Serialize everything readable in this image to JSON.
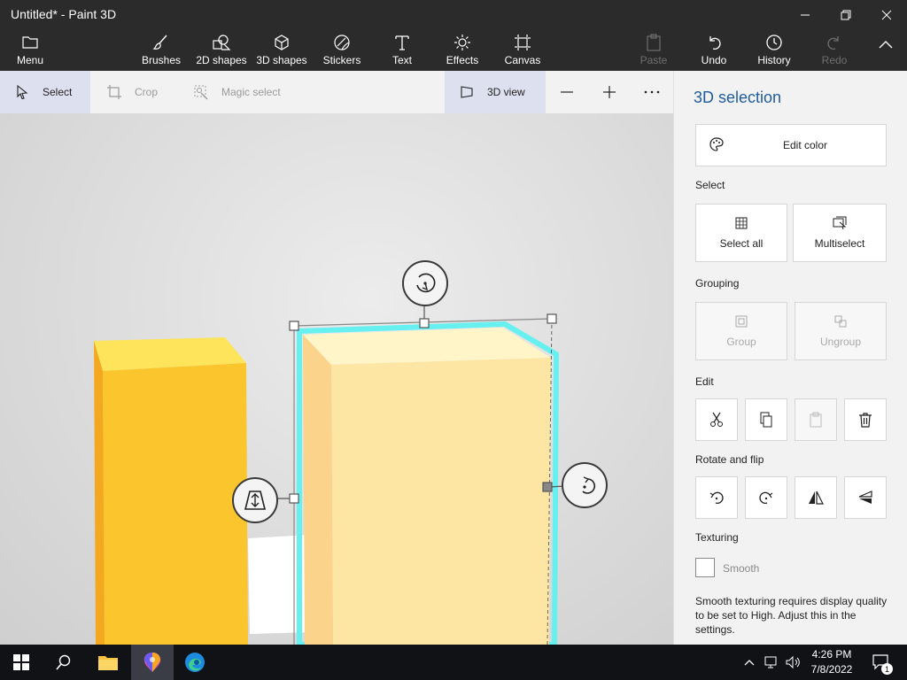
{
  "window": {
    "title": "Untitled* - Paint 3D"
  },
  "ribbon": {
    "menu": "Menu",
    "tools": [
      {
        "label": "Brushes"
      },
      {
        "label": "2D shapes"
      },
      {
        "label": "3D shapes"
      },
      {
        "label": "Stickers"
      },
      {
        "label": "Text"
      },
      {
        "label": "Effects"
      },
      {
        "label": "Canvas"
      }
    ],
    "paste": "Paste",
    "undo": "Undo",
    "history": "History",
    "redo": "Redo"
  },
  "toolbar": {
    "select": "Select",
    "crop": "Crop",
    "magic_select": "Magic select",
    "view3d": "3D view",
    "zoom_out": "—",
    "zoom_in": "+",
    "more": "···"
  },
  "panel": {
    "title": "3D selection",
    "edit_color": "Edit color",
    "select_label": "Select",
    "select_all": "Select all",
    "multiselect": "Multiselect",
    "grouping_label": "Grouping",
    "group": "Group",
    "ungroup": "Ungroup",
    "edit_label": "Edit",
    "rotate_label": "Rotate and flip",
    "texturing_label": "Texturing",
    "smooth": "Smooth",
    "note": "Smooth texturing requires display quality to be set to High. Adjust this in the settings."
  },
  "taskbar": {
    "time": "4:26 PM",
    "date": "7/8/2022",
    "notification_count": "1"
  },
  "colors": {
    "accent": "#1f5c9e",
    "selection_outline": "#66f0f0",
    "yellow_box": "#fbc02d",
    "pale_box": "#fde6a4"
  }
}
